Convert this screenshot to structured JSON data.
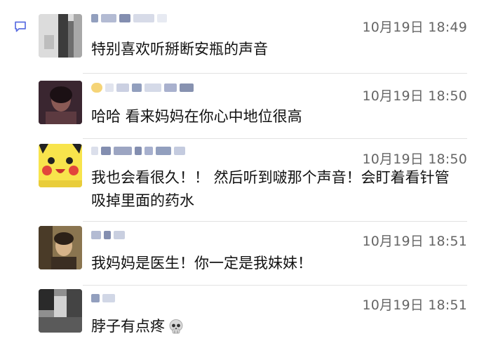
{
  "icons": {
    "comment": "comment-bubble-icon",
    "skull_emoji": "skull-emoji-icon"
  },
  "colors": {
    "accent": "#5b6ee1",
    "time": "#666666",
    "divider": "#e2e2e2"
  },
  "comments": [
    {
      "time": "10月19日 18:49",
      "text": "特别喜欢听掰断安瓶的声音"
    },
    {
      "time": "10月19日 18:50",
      "text": "哈哈 看来妈妈在你心中地位很高"
    },
    {
      "time": "10月19日 18:50",
      "text": "我也会看很久！！ 然后听到啵那个声音！会盯着看针管吸掉里面的药水"
    },
    {
      "time": "10月19日 18:51",
      "text": "我妈妈是医生！你一定是我妹妹！"
    },
    {
      "time": "10月19日 18:51",
      "text": "脖子有点疼"
    }
  ]
}
